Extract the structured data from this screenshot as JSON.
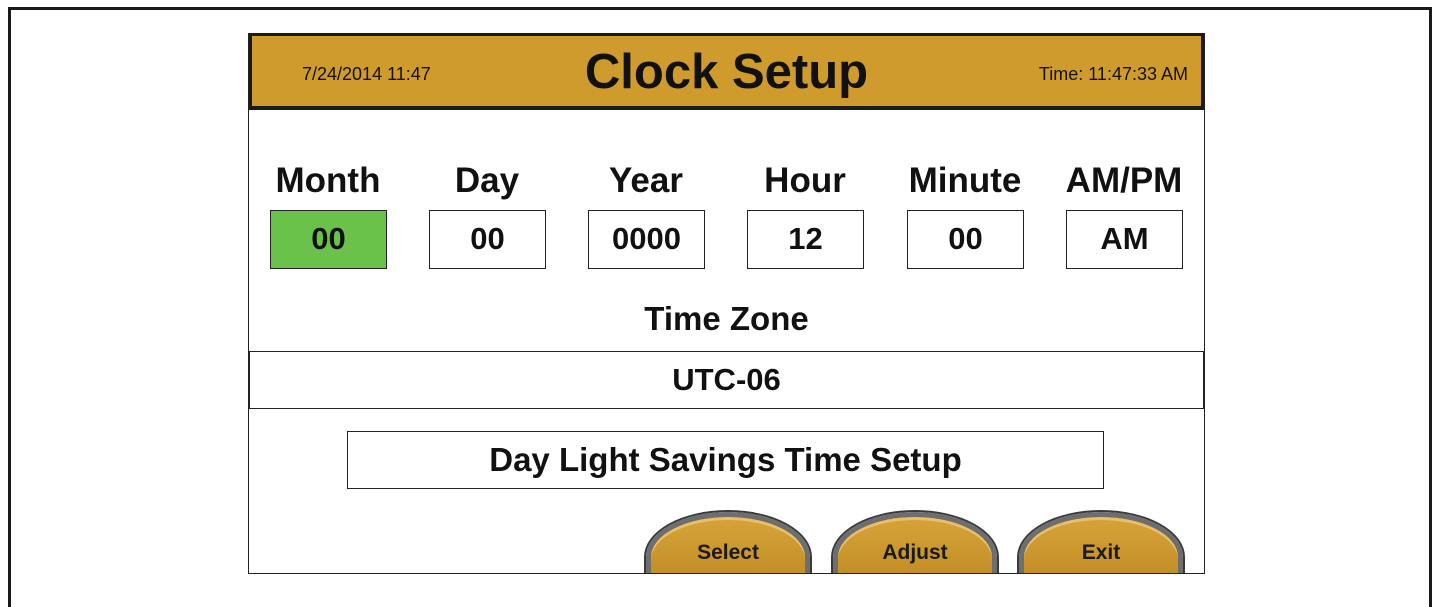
{
  "header": {
    "date": "7/24/2014 11:47",
    "title": "Clock Setup",
    "time": "Time: 11:47:33 AM"
  },
  "fields": [
    {
      "label": "Month",
      "value": "00"
    },
    {
      "label": "Day",
      "value": "00"
    },
    {
      "label": "Year",
      "value": "0000"
    },
    {
      "label": "Hour",
      "value": "12"
    },
    {
      "label": "Minute",
      "value": "00"
    },
    {
      "label": "AM/PM",
      "value": "AM"
    }
  ],
  "timezone": {
    "label": "Time Zone",
    "value": "UTC-06"
  },
  "dst_button": "Day Light Savings Time Setup",
  "softkeys": {
    "select": "Select",
    "adjust": "Adjust",
    "exit": "Exit"
  },
  "colors": {
    "header": "#cf9b2c",
    "selected_field": "#6ac24a",
    "softkey": "#cf9b2c"
  }
}
